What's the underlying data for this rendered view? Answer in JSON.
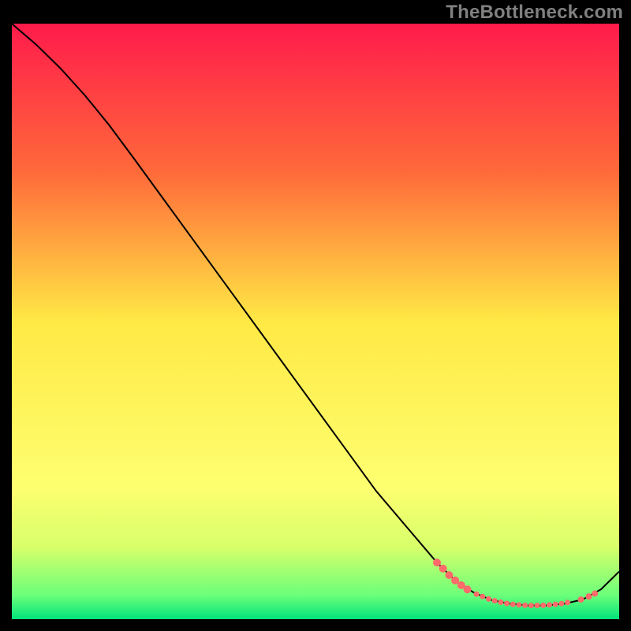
{
  "watermark": "TheBottleneck.com",
  "chart_data": {
    "type": "line",
    "title": "",
    "xlabel": "",
    "ylabel": "",
    "xlim": [
      0,
      100
    ],
    "ylim": [
      0,
      100
    ],
    "grid": false,
    "legend": false,
    "background_gradient": {
      "stops": [
        {
          "pct": 0,
          "color": "#ff1b4b"
        },
        {
          "pct": 25,
          "color": "#ff6a3a"
        },
        {
          "pct": 50,
          "color": "#ffe945"
        },
        {
          "pct": 78,
          "color": "#feff70"
        },
        {
          "pct": 88,
          "color": "#d6ff6a"
        },
        {
          "pct": 96,
          "color": "#6bff7a"
        },
        {
          "pct": 100,
          "color": "#00e37a"
        }
      ]
    },
    "series": [
      {
        "name": "curve",
        "color": "#000000",
        "x": [
          0,
          4,
          8,
          12,
          16,
          20,
          25,
          30,
          35,
          40,
          45,
          50,
          55,
          60,
          65,
          70,
          73,
          76,
          79,
          82,
          85,
          88,
          91,
          94,
          97,
          100
        ],
        "y": [
          100,
          96.5,
          92.5,
          88.0,
          83.0,
          77.5,
          70.5,
          63.5,
          56.5,
          49.5,
          42.5,
          35.5,
          28.5,
          21.5,
          15.5,
          9.5,
          6.5,
          4.5,
          3.2,
          2.6,
          2.3,
          2.3,
          2.6,
          3.3,
          5.0,
          8.0
        ]
      }
    ],
    "markers": {
      "name": "highlight-points",
      "color": "#ff6b6b",
      "radius_large": 5,
      "radius_small": 3.5,
      "points": [
        {
          "x": 70.0,
          "y": 9.5,
          "r": 5
        },
        {
          "x": 71.0,
          "y": 8.5,
          "r": 5
        },
        {
          "x": 72.0,
          "y": 7.4,
          "r": 5
        },
        {
          "x": 73.0,
          "y": 6.5,
          "r": 5
        },
        {
          "x": 74.0,
          "y": 5.7,
          "r": 5
        },
        {
          "x": 75.0,
          "y": 5.0,
          "r": 5
        },
        {
          "x": 76.5,
          "y": 4.2,
          "r": 3.5
        },
        {
          "x": 77.5,
          "y": 3.8,
          "r": 3.5
        },
        {
          "x": 78.5,
          "y": 3.4,
          "r": 3.5
        },
        {
          "x": 79.5,
          "y": 3.1,
          "r": 3.5
        },
        {
          "x": 80.5,
          "y": 2.85,
          "r": 3.5
        },
        {
          "x": 81.5,
          "y": 2.65,
          "r": 3.5
        },
        {
          "x": 82.5,
          "y": 2.5,
          "r": 3.5
        },
        {
          "x": 83.5,
          "y": 2.4,
          "r": 3.5
        },
        {
          "x": 84.5,
          "y": 2.33,
          "r": 3.5
        },
        {
          "x": 85.5,
          "y": 2.3,
          "r": 3.5
        },
        {
          "x": 86.5,
          "y": 2.3,
          "r": 3.5
        },
        {
          "x": 87.5,
          "y": 2.33,
          "r": 3.5
        },
        {
          "x": 88.5,
          "y": 2.4,
          "r": 3.5
        },
        {
          "x": 89.5,
          "y": 2.5,
          "r": 3.5
        },
        {
          "x": 90.5,
          "y": 2.62,
          "r": 3.5
        },
        {
          "x": 91.5,
          "y": 2.8,
          "r": 3.5
        },
        {
          "x": 93.7,
          "y": 3.3,
          "r": 4
        },
        {
          "x": 95.0,
          "y": 3.8,
          "r": 4
        },
        {
          "x": 96.0,
          "y": 4.3,
          "r": 4
        }
      ]
    }
  }
}
